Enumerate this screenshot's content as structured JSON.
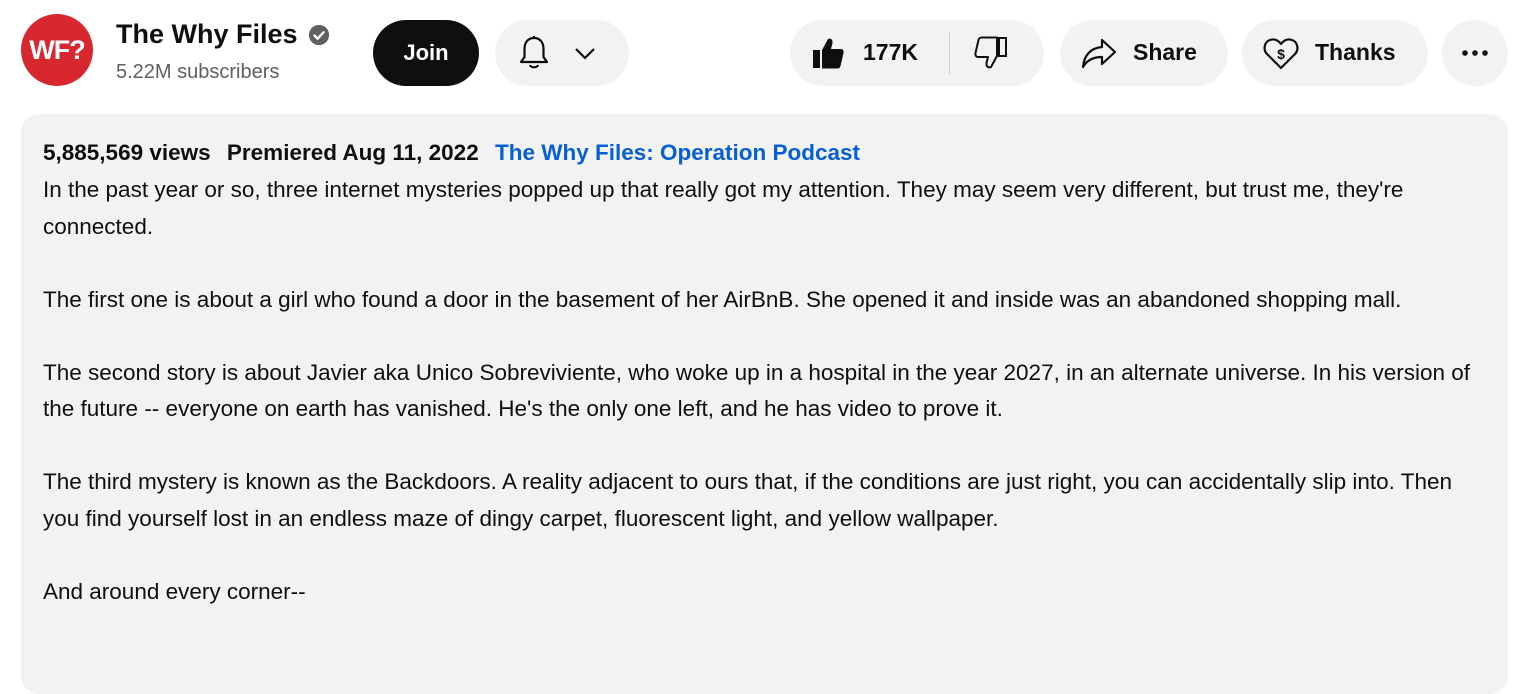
{
  "channel": {
    "avatar_text": "WF?",
    "name": "The Why Files",
    "subscribers": "5.22M subscribers",
    "brand_color": "#d8282f"
  },
  "actions": {
    "join_label": "Join",
    "like_count": "177K",
    "share_label": "Share",
    "thanks_label": "Thanks",
    "more_label": "⋯"
  },
  "description": {
    "views": "5,885,569 views",
    "premiered": "Premiered Aug 11, 2022",
    "playlist_link": "The Why Files: Operation Podcast",
    "link_color": "#065fd4",
    "paragraphs": [
      "In the past year or so, three internet mysteries popped up that really got my attention. They may seem very different, but trust me, they're connected.",
      "The first one is about a girl who found a door in the basement of her AirBnB. She opened it and inside was an abandoned shopping mall.",
      "The second story is about Javier aka Unico Sobreviviente, who woke up in a hospital in the year 2027, in an alternate universe. In his version of the future -- everyone on earth has vanished. He's the only one left, and he has video to prove it.",
      "The third mystery is known as the Backdoors. A reality adjacent to ours that, if the conditions are just right, you can accidentally slip into. Then you find yourself lost in an endless maze of dingy carpet, fluorescent light, and yellow wallpaper.",
      "And around every corner--"
    ]
  }
}
